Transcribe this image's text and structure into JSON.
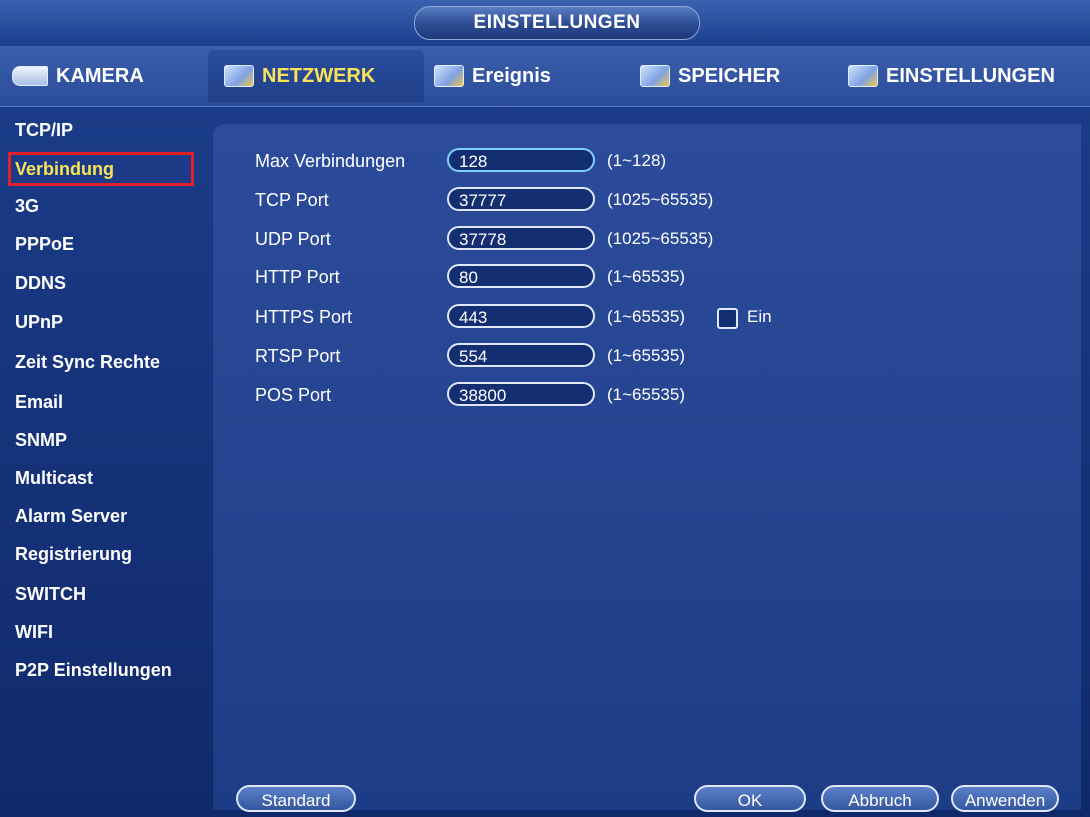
{
  "window": {
    "title": "EINSTELLUNGEN"
  },
  "tabs": [
    {
      "label": "KAMERA",
      "icon": "camera-icon",
      "active": false
    },
    {
      "label": "NETZWERK",
      "icon": "network-icon",
      "active": true
    },
    {
      "label": "Ereignis",
      "icon": "event-icon",
      "active": false
    },
    {
      "label": "SPEICHER",
      "icon": "storage-icon",
      "active": false
    },
    {
      "label": "EINSTELLUNGEN",
      "icon": "settings-icon",
      "active": false
    }
  ],
  "sidebar": {
    "items": [
      {
        "label": "TCP/IP"
      },
      {
        "label": "Verbindung"
      },
      {
        "label": "3G"
      },
      {
        "label": "PPPoE"
      },
      {
        "label": "DDNS"
      },
      {
        "label": "UPnP"
      },
      {
        "label": "Zeit Sync Rechte"
      },
      {
        "label": "Email"
      },
      {
        "label": "SNMP"
      },
      {
        "label": "Multicast"
      },
      {
        "label": "Alarm Server"
      },
      {
        "label": "Registrierung"
      },
      {
        "label": "SWITCH"
      },
      {
        "label": "WIFI"
      },
      {
        "label": "P2P Einstellungen"
      }
    ],
    "selected": "Verbindung"
  },
  "form": {
    "rows": [
      {
        "label": "Max Verbindungen",
        "value": "128",
        "range": "(1~128)"
      },
      {
        "label": "TCP Port",
        "value": "37777",
        "range": "(1025~65535)"
      },
      {
        "label": "UDP Port",
        "value": "37778",
        "range": "(1025~65535)"
      },
      {
        "label": "HTTP Port",
        "value": "80",
        "range": "(1~65535)"
      },
      {
        "label": "HTTPS Port",
        "value": "443",
        "range": "(1~65535)",
        "checkbox_label": "Ein",
        "checked": false
      },
      {
        "label": "RTSP Port",
        "value": "554",
        "range": "(1~65535)"
      },
      {
        "label": "POS Port",
        "value": "38800",
        "range": "(1~65535)"
      }
    ]
  },
  "buttons": {
    "standard": "Standard",
    "ok": "OK",
    "cancel": "Abbruch",
    "apply": "Anwenden"
  },
  "colors": {
    "active_text": "#f7e35a",
    "selection_outline": "#e0202a",
    "background": "#17367f"
  }
}
